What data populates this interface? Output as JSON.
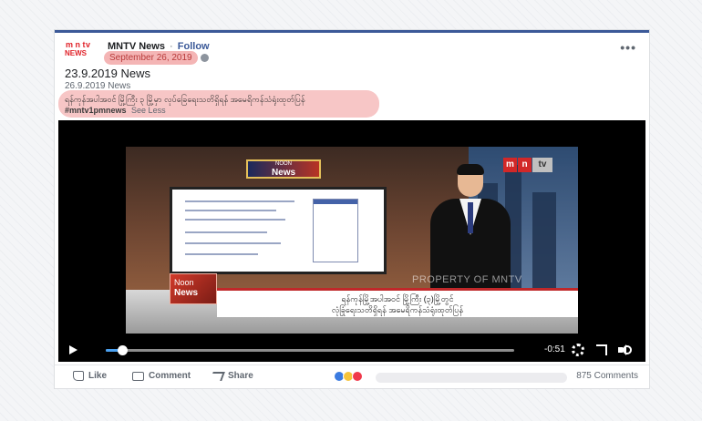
{
  "post": {
    "page_name": "MNTV News",
    "separator": "·",
    "follow_label": "Follow",
    "posted_date": "September 26, 2019",
    "title": "23.9.2019 News",
    "subtitle_date": "26.9.2019 News",
    "caption": "ရန်ကုန်အပါအဝင် မြို့ကြီး ၃ မြို့မှာ လုပ်ခြေရေးသတိရှိရန် အမေရိကန်သံရုံးထုတ်ပြန်",
    "hashtag": "#mntv1pmnews",
    "see_less_label": "See Less",
    "more_icon": "•••"
  },
  "logo": {
    "top": [
      "m",
      "n",
      "tv"
    ],
    "bottom": "NEWS"
  },
  "video": {
    "noon_top": {
      "line1": "NOON",
      "line2": "News"
    },
    "noon_lower": {
      "line1": "Noon",
      "line2": "News"
    },
    "channel_badge": [
      "m",
      "n",
      "tv"
    ],
    "watermark": "PROPERTY OF MNTV",
    "ticker_line1": "ရန်ကုန်မြို့အပါအဝင် မြို့ကြီး (၃)မြို့တွင်",
    "ticker_line2": "လုံခြုံရေးသတိရှိရန် အမေရိကန်သံရုံးထုတ်ပြန်",
    "time_remaining": "-0:51",
    "progress_fraction": 0.04
  },
  "actions": {
    "like_label": "Like",
    "comment_label": "Comment",
    "share_label": "Share",
    "comments_count": "875 Comments"
  },
  "colors": {
    "brand": "#3b5998",
    "highlight": "#f4b5b5",
    "mntv_red": "#d22828"
  }
}
